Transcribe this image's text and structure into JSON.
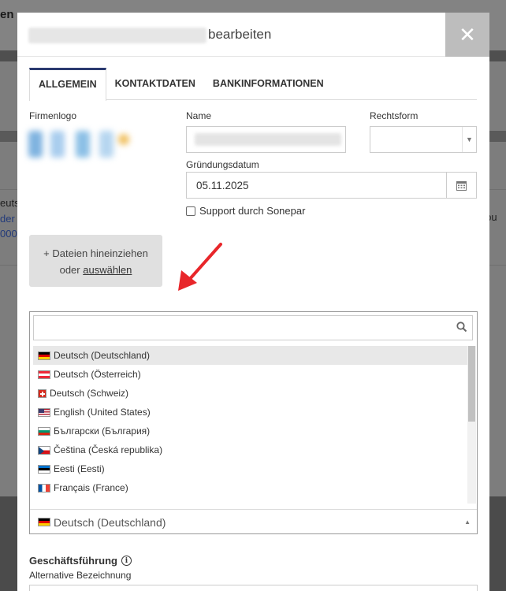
{
  "background": {
    "title": "en",
    "left_texts": [
      "euts",
      "der",
      "000"
    ],
    "right_text": "eibu"
  },
  "modal": {
    "title_suffix": "bearbeiten",
    "close_label": "✕",
    "tabs": [
      "ALLGEMEIN",
      "KONTAKTDATEN",
      "BANKINFORMATIONEN"
    ],
    "fields": {
      "logo_label": "Firmenlogo",
      "name_label": "Name",
      "legal_form_label": "Rechtsform",
      "founding_date_label": "Gründungsdatum",
      "founding_date_value": "05.11.2025",
      "support_label": "Support durch Sonepar"
    },
    "dropzone": {
      "line1": "+ Dateien hineinziehen",
      "line2_prefix": "oder ",
      "line2_link": "auswählen"
    },
    "language_dropdown": {
      "search_placeholder": "",
      "items": [
        {
          "label": "Deutsch (Deutschland)",
          "flag": "de"
        },
        {
          "label": "Deutsch (Österreich)",
          "flag": "at"
        },
        {
          "label": "Deutsch (Schweiz)",
          "flag": "ch"
        },
        {
          "label": "English (United States)",
          "flag": "us"
        },
        {
          "label": "Български (България)",
          "flag": "bg"
        },
        {
          "label": "Čeština (Česká republika)",
          "flag": "cz"
        },
        {
          "label": "Eesti (Eesti)",
          "flag": "ee"
        },
        {
          "label": "Français (France)",
          "flag": "fr"
        }
      ],
      "selected": "Deutsch (Deutschland)"
    },
    "management_title": "Geschäftsführung",
    "alternative_label": "Alternative Bezeichnung"
  },
  "colors": {
    "accent": "#2b3a70",
    "arrow": "#e8262a"
  }
}
